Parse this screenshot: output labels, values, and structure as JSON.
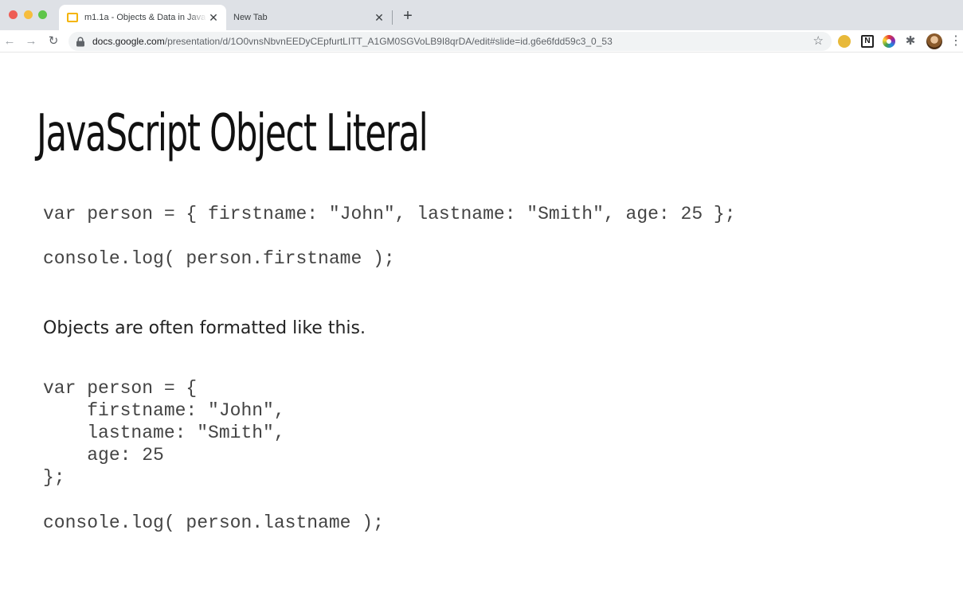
{
  "browser": {
    "tabs": [
      {
        "title": "m1.1a - Objects & Data in Java",
        "close": "✕"
      },
      {
        "title": "New Tab",
        "close": "✕"
      }
    ],
    "new_tab": "+",
    "nav": {
      "back": "←",
      "forward": "→",
      "reload": "↻"
    },
    "url": {
      "host": "docs.google.com",
      "path": "/presentation/d/1O0vnsNbvnEEDyCEpfurtLITT_A1GM0SGVoLB9I8qrDA/edit#slide=id.g6e6fdd59c3_0_53"
    },
    "bookmark": "☆",
    "extensions": {
      "notion": "N",
      "puzzle": "✱"
    },
    "menu": "⋮"
  },
  "slide": {
    "title": "JavaScript Object Literal",
    "code_line_1": "var person = { firstname: \"John\", lastname: \"Smith\", age: 25 };",
    "code_line_2": "console.log( person.firstname );",
    "body_text": "Objects are often formatted like this.",
    "code_block": [
      "var person = {",
      "    firstname: \"John\",",
      "    lastname: \"Smith\",",
      "    age: 25",
      "};"
    ],
    "code_line_3": "console.log( person.lastname );"
  }
}
